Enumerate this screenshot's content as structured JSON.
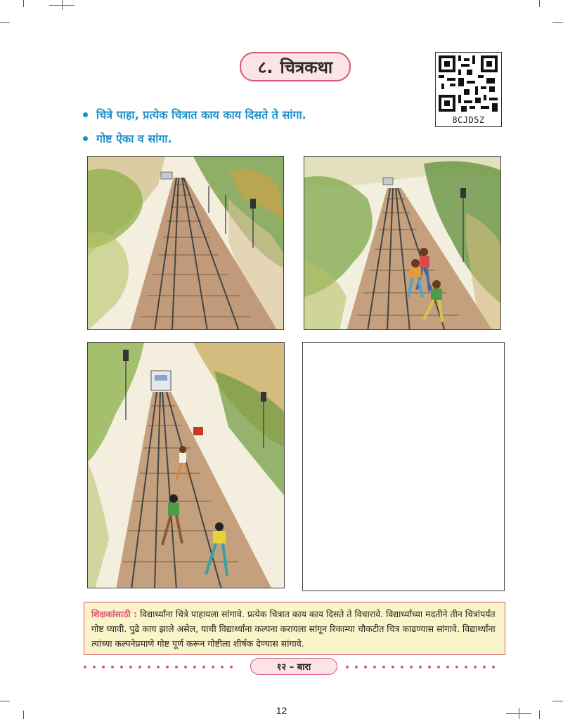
{
  "chapter": {
    "number": "८.",
    "title": "चित्रकथा"
  },
  "qr": {
    "code": "8CJD5Z"
  },
  "instructions": [
    "चित्रे पाहा, प्रत्येक चित्रात काय काय दिसते ते सांगा.",
    "गोष्ट ऐका व सांगा."
  ],
  "note": {
    "label": "शिक्षकांसाठी :",
    "text": "विद्यार्थ्यांना चित्रे पाहायला सांगावे. प्रत्येक चित्रात काय काय दिसते ते विचारावे. विद्यार्थ्यांच्या मदतीने तीन चित्रांपर्यंत गोष्ट घ्यावी. पुढे काय झाले असेल, याची विद्यार्थ्यांना कल्पना करायला सांगून रिकाम्या चौकटीत चित्र काढण्यास सांगावे. विद्यार्थ्यांना त्यांच्या कल्पनेप्रमाणे गोष्ट पूर्ण करून गोष्टीला शीर्षक देण्यास सांगावे."
  },
  "footer": {
    "tag": "१२ – बारा",
    "page_number": "12"
  },
  "colors": {
    "accent": "#d9577a",
    "instruction": "#1a8fc9",
    "note_bg": "#fbf4c8"
  }
}
